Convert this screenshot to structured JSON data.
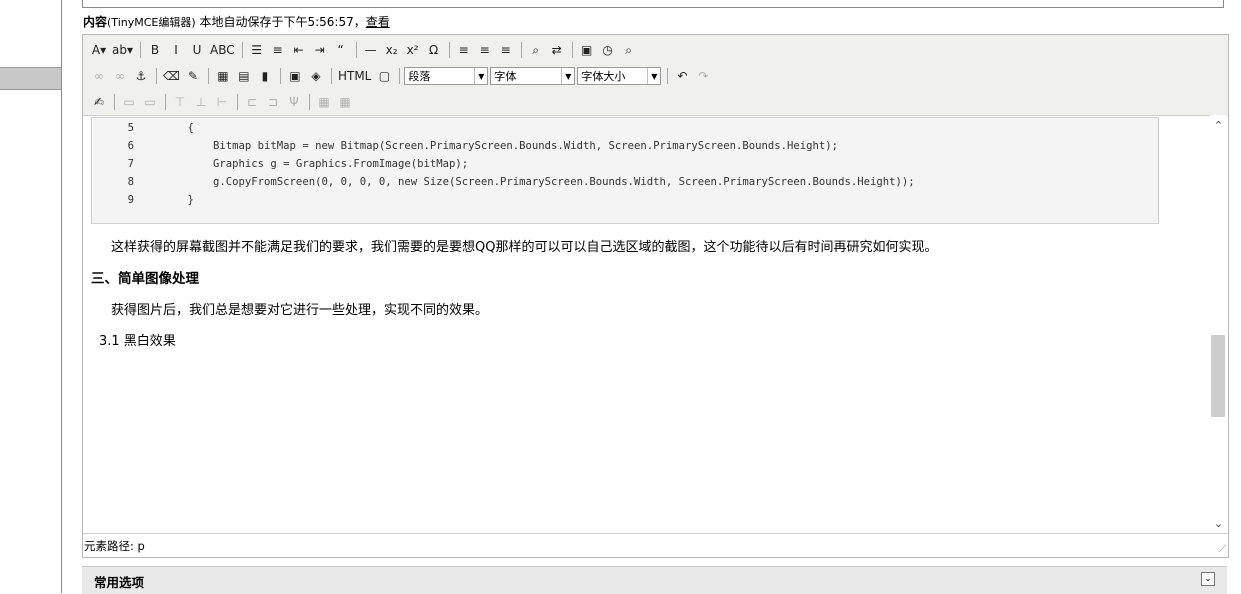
{
  "content_label": {
    "bold": "内容",
    "editor_name": "(TinyMCE编辑器)",
    "autosave": "本地自动保存于下午5:56:57，",
    "view_link": "查看"
  },
  "toolbar": {
    "row1": [
      {
        "name": "font-color-icon",
        "glyph": "A▾"
      },
      {
        "name": "highlight-color-icon",
        "glyph": "ab▾"
      },
      {
        "sep": true
      },
      {
        "name": "bold-icon",
        "glyph": "B"
      },
      {
        "name": "italic-icon",
        "glyph": "I"
      },
      {
        "name": "underline-icon",
        "glyph": "U"
      },
      {
        "name": "strikethrough-icon",
        "glyph": "ABC"
      },
      {
        "sep": true
      },
      {
        "name": "bullet-list-icon",
        "glyph": "☰"
      },
      {
        "name": "numbered-list-icon",
        "glyph": "≡"
      },
      {
        "name": "outdent-icon",
        "glyph": "⇤"
      },
      {
        "name": "indent-icon",
        "glyph": "⇥"
      },
      {
        "name": "blockquote-icon",
        "glyph": "“"
      },
      {
        "sep": true
      },
      {
        "name": "horizontal-rule-icon",
        "glyph": "—"
      },
      {
        "name": "subscript-icon",
        "glyph": "x₂"
      },
      {
        "name": "superscript-icon",
        "glyph": "x²"
      },
      {
        "name": "special-char-icon",
        "glyph": "Ω"
      },
      {
        "sep": true
      },
      {
        "name": "align-left-icon",
        "glyph": "≡"
      },
      {
        "name": "align-center-icon",
        "glyph": "≡"
      },
      {
        "name": "align-right-icon",
        "glyph": "≡"
      },
      {
        "sep": true
      },
      {
        "name": "find-icon",
        "glyph": "⌕"
      },
      {
        "name": "replace-icon",
        "glyph": "⇄"
      },
      {
        "sep": true
      },
      {
        "name": "paste-word-icon",
        "glyph": "▣"
      },
      {
        "name": "insert-time-icon",
        "glyph": "◷"
      },
      {
        "name": "preview-icon",
        "glyph": "⌕"
      }
    ],
    "row2": [
      {
        "name": "link-icon",
        "glyph": "∞",
        "disabled": true
      },
      {
        "name": "unlink-icon",
        "glyph": "∞",
        "disabled": true
      },
      {
        "name": "anchor-icon",
        "glyph": "⚓"
      },
      {
        "sep": true
      },
      {
        "name": "eraser-icon",
        "glyph": "⌫"
      },
      {
        "name": "cleanup-icon",
        "glyph": "✎"
      },
      {
        "sep": true
      },
      {
        "name": "image-icon",
        "glyph": "▦"
      },
      {
        "name": "media-icon",
        "glyph": "▤"
      },
      {
        "name": "page-break-icon",
        "glyph": "▮"
      },
      {
        "sep": true
      },
      {
        "name": "insert-code-icon",
        "glyph": "▣"
      },
      {
        "name": "embed-icon",
        "glyph": "◈"
      },
      {
        "sep": true
      },
      {
        "name": "html-source-icon",
        "glyph": "HTML"
      },
      {
        "name": "fullscreen-icon",
        "glyph": "▢"
      }
    ],
    "selects": [
      {
        "name": "paragraph-select",
        "value": "段落",
        "width": 84
      },
      {
        "name": "font-family-select",
        "value": "字体",
        "width": 85
      },
      {
        "name": "font-size-select",
        "value": "字体大小",
        "width": 84
      }
    ],
    "row2_after": [
      {
        "sep": true
      },
      {
        "name": "undo-icon",
        "glyph": "↶"
      },
      {
        "name": "redo-icon",
        "glyph": "↷",
        "disabled": true
      }
    ],
    "row3": [
      {
        "name": "edit-icon",
        "glyph": "✍"
      },
      {
        "sep": true
      },
      {
        "name": "table-row-props-icon",
        "glyph": "▭",
        "disabled": true
      },
      {
        "name": "table-cell-props-icon",
        "glyph": "▭",
        "disabled": true
      },
      {
        "sep": true
      },
      {
        "name": "insert-row-before-icon",
        "glyph": "⊤",
        "disabled": true
      },
      {
        "name": "insert-row-after-icon",
        "glyph": "⊥",
        "disabled": true
      },
      {
        "name": "delete-row-icon",
        "glyph": "⊢",
        "disabled": true
      },
      {
        "sep": true
      },
      {
        "name": "insert-col-before-icon",
        "glyph": "⊏",
        "disabled": true
      },
      {
        "name": "insert-col-after-icon",
        "glyph": "⊐",
        "disabled": true
      },
      {
        "name": "delete-col-icon",
        "glyph": "Ψ",
        "disabled": true
      },
      {
        "sep": true
      },
      {
        "name": "split-cells-icon",
        "glyph": "▦",
        "disabled": true
      },
      {
        "name": "merge-cells-icon",
        "glyph": "▦",
        "disabled": true
      }
    ]
  },
  "code": [
    {
      "n": "5",
      "t": "    {"
    },
    {
      "n": "6",
      "t": "        Bitmap bitMap = new Bitmap(Screen.PrimaryScreen.Bounds.Width, Screen.PrimaryScreen.Bounds.Height);"
    },
    {
      "n": "7",
      "t": "        Graphics g = Graphics.FromImage(bitMap);"
    },
    {
      "n": "8",
      "t": "        g.CopyFromScreen(0, 0, 0, 0, new Size(Screen.PrimaryScreen.Bounds.Width, Screen.PrimaryScreen.Bounds.Height));"
    },
    {
      "n": "9",
      "t": "    }"
    }
  ],
  "paragraphs": {
    "p1": "这样获得的屏幕截图并不能满足我们的要求，我们需要的是要想QQ那样的可以可以自己选区域的截图，这个功能待以后有时间再研究如何实现。",
    "h3": "三、简单图像处理",
    "p2": "获得图片后，我们总是想要对它进行一些处理，实现不同的效果。",
    "p3": "3.1 黑白效果"
  },
  "statusbar": {
    "path": "元素路径: p"
  },
  "options": {
    "label": "常用选项"
  }
}
